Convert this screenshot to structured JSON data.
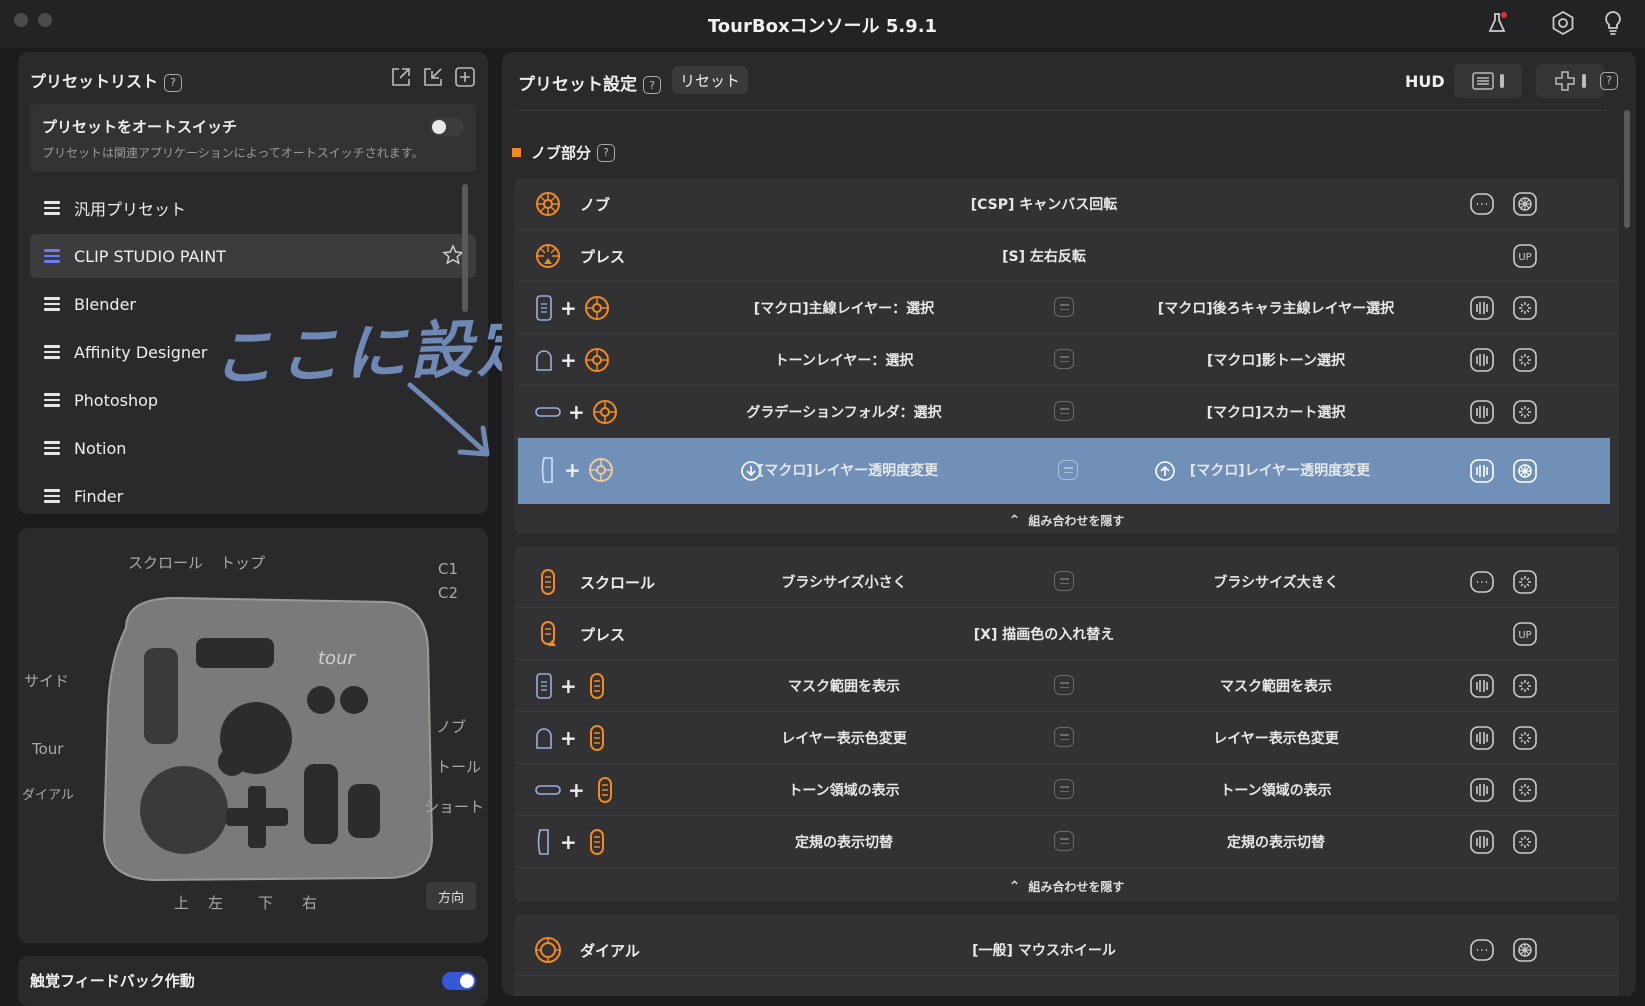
{
  "app_title": "TourBoxコンソール 5.9.1",
  "colors": {
    "accent_orange": "#f08a24",
    "selected_row": "#7090b8",
    "toggle_on": "#3557d6",
    "active_preset_icon": "#6c7cf7"
  },
  "preset_panel": {
    "title": "プリセットリスト",
    "help": "?",
    "auto_switch": {
      "title": "プリセットをオートスイッチ",
      "description": "プリセットは関連アプリケーションによってオートスイッチされます。",
      "enabled": false
    },
    "items": [
      {
        "label": "汎用プリセット",
        "active": false
      },
      {
        "label": "CLIP STUDIO PAINT",
        "active": true
      },
      {
        "label": "Blender",
        "active": false
      },
      {
        "label": "Affinity Designer",
        "active": false
      },
      {
        "label": "Photoshop",
        "active": false
      },
      {
        "label": "Notion",
        "active": false
      },
      {
        "label": "Finder",
        "active": false
      }
    ],
    "handwritten_note": "ここに設定"
  },
  "device_panel": {
    "labels": {
      "scroll": "スクロール",
      "top": "トップ",
      "c1": "C1",
      "c2": "C2",
      "side": "サイド",
      "knob": "ノブ",
      "tour": "Tour",
      "tall": "トール",
      "dial": "ダイアル",
      "short": "ショート",
      "up": "上",
      "left": "左",
      "down": "下",
      "right": "右"
    },
    "direction_button": "方向"
  },
  "haptic": {
    "label": "触覚フィードバック作動",
    "enabled": true
  },
  "settings": {
    "title": "プリセット設定",
    "help": "?",
    "reset": "リセット",
    "hud": "HUD",
    "sections": [
      {
        "title": "ノブ部分",
        "rows": [
          {
            "name": "ノブ",
            "action": "[CSP] キャンバス回転"
          },
          {
            "name": "プレス",
            "action": "[S] 左右反転"
          },
          {
            "left": "[マクロ]主線レイヤー：選択",
            "right": "[マクロ]後ろキャラ主線レイヤー選択"
          },
          {
            "left": "トーンレイヤー：選択",
            "right": "[マクロ]影トーン選択"
          },
          {
            "left": "グラデーションフォルダ：選択",
            "right": "[マクロ]スカート選択"
          },
          {
            "left": "[マクロ]レイヤー透明度変更",
            "right": "[マクロ]レイヤー透明度変更",
            "selected": true
          }
        ],
        "hide_combo": "組み合わせを隠す"
      },
      {
        "rows": [
          {
            "name": "スクロール",
            "left": "ブラシサイズ小さく",
            "right": "ブラシサイズ大きく"
          },
          {
            "name": "プレス",
            "action": "[X] 描画色の入れ替え"
          },
          {
            "left": "マスク範囲を表示",
            "right": "マスク範囲を表示"
          },
          {
            "left": "レイヤー表示色変更",
            "right": "レイヤー表示色変更"
          },
          {
            "left": "トーン領域の表示",
            "right": "トーン領域の表示"
          },
          {
            "left": "定規の表示切替",
            "right": "定規の表示切替"
          }
        ],
        "hide_combo": "組み合わせを隠す"
      },
      {
        "rows": [
          {
            "name": "ダイアル",
            "action": "[一般] マウスホイール"
          }
        ]
      }
    ]
  }
}
